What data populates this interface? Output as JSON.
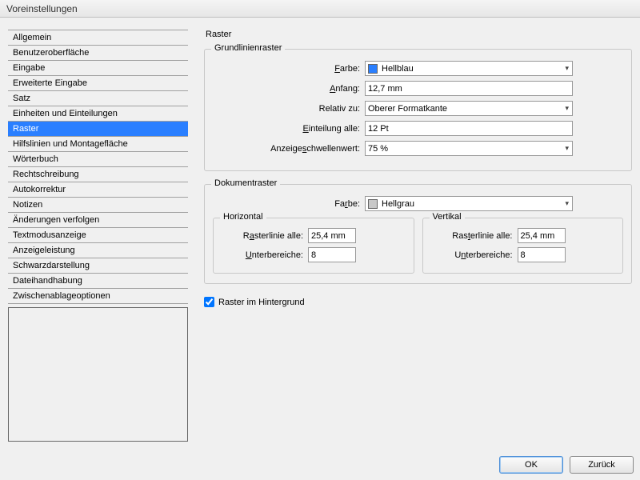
{
  "window": {
    "title": "Voreinstellungen"
  },
  "sidebar": {
    "items": [
      {
        "label": "Allgemein"
      },
      {
        "label": "Benutzeroberfläche"
      },
      {
        "label": "Eingabe"
      },
      {
        "label": "Erweiterte Eingabe"
      },
      {
        "label": "Satz"
      },
      {
        "label": "Einheiten und Einteilungen"
      },
      {
        "label": "Raster"
      },
      {
        "label": "Hilfslinien und Montagefläche"
      },
      {
        "label": "Wörterbuch"
      },
      {
        "label": "Rechtschreibung"
      },
      {
        "label": "Autokorrektur"
      },
      {
        "label": "Notizen"
      },
      {
        "label": "Änderungen verfolgen"
      },
      {
        "label": "Textmodusanzeige"
      },
      {
        "label": "Anzeigeleistung"
      },
      {
        "label": "Schwarzdarstellung"
      },
      {
        "label": "Dateihandhabung"
      },
      {
        "label": "Zwischenablageoptionen"
      }
    ],
    "selected_index": 6
  },
  "page": {
    "title": "Raster"
  },
  "baseline": {
    "group_title": "Grundlinienraster",
    "color_label": "Farbe:",
    "color_value": "Hellblau",
    "start_label": "Anfang:",
    "start_value": "12,7 mm",
    "relative_label": "Relativ zu:",
    "relative_value": "Oberer Formatkante",
    "increment_label": "Einteilung alle:",
    "increment_value": "12 Pt",
    "threshold_label": "Anzeigeschwellenwert:",
    "threshold_value": "75 %"
  },
  "docgrid": {
    "group_title": "Dokumentraster",
    "color_label": "Farbe:",
    "color_value": "Hellgrau",
    "horizontal": {
      "title": "Horizontal",
      "gridline_label": "Rasterlinie alle:",
      "gridline_value": "25,4 mm",
      "subdiv_label": "Unterbereiche:",
      "subdiv_value": "8"
    },
    "vertical": {
      "title": "Vertikal",
      "gridline_label": "Rasterlinie alle:",
      "gridline_value": "25,4 mm",
      "subdiv_label": "Unterbereiche:",
      "subdiv_value": "8"
    }
  },
  "grid_in_back": {
    "label": "Raster im Hintergrund",
    "checked": true
  },
  "buttons": {
    "ok": "OK",
    "back": "Zurück"
  }
}
